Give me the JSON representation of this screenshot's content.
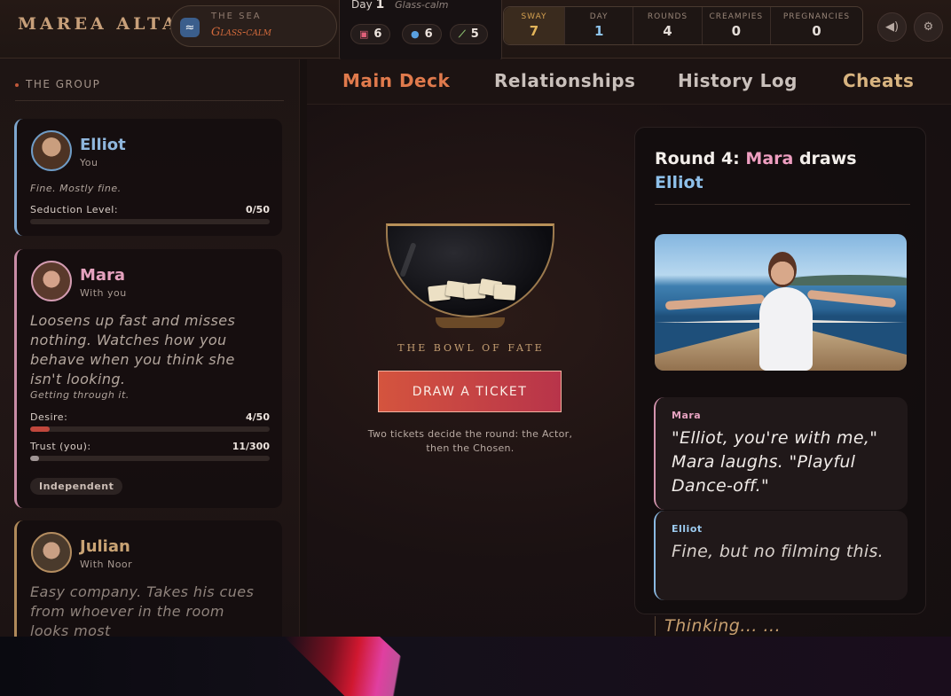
{
  "header": {
    "brand": "MAREA ALTA",
    "sea": {
      "label": "THE SEA",
      "value": "Glass-calm",
      "icon": "wave-icon"
    },
    "day": {
      "label": "Day",
      "number": "1",
      "condition": "Glass-calm"
    },
    "resources": [
      {
        "icon": "drink-icon",
        "value": "6"
      },
      {
        "icon": "droplet-icon",
        "value": "6"
      },
      {
        "icon": "bottle-icon",
        "value": "5"
      }
    ],
    "stats": [
      {
        "label": "SWAY",
        "value": "7"
      },
      {
        "label": "DAY",
        "value": "1"
      },
      {
        "label": "ROUNDS",
        "value": "4"
      },
      {
        "label": "CREAMPIES",
        "value": "0"
      },
      {
        "label": "PREGNANCIES",
        "value": "0"
      }
    ],
    "sound_icon": "speaker-icon",
    "settings_icon": "gear-icon"
  },
  "sidebar": {
    "title": "THE GROUP",
    "characters": [
      {
        "name": "Elliot",
        "subtitle": "You",
        "mood": "Fine. Mostly fine.",
        "meter_label": "Seduction Level:",
        "meter_value": "0/50",
        "meter_fraction": 0.0
      },
      {
        "name": "Mara",
        "subtitle": "With you",
        "description": "Loosens up fast and misses nothing. Watches how you behave when you think she isn't looking.",
        "mood": "Getting through it.",
        "desire_label": "Desire:",
        "desire_value": "4/50",
        "desire_fraction": 0.08,
        "trust_label": "Trust (you):",
        "trust_value": "11/300",
        "trust_fraction": 0.037,
        "tag": "Independent"
      },
      {
        "name": "Julian",
        "subtitle": "With Noor",
        "description": "Easy company. Takes his cues from whoever in the room looks most"
      }
    ]
  },
  "tabs": [
    {
      "label": "Main Deck",
      "active": true
    },
    {
      "label": "Relationships",
      "active": false
    },
    {
      "label": "History Log",
      "active": false
    },
    {
      "label": "Cheats",
      "active": false
    }
  ],
  "deck": {
    "bowl_caption": "THE BOWL OF FATE",
    "draw_button": "DRAW A TICKET",
    "note": "Two tickets decide the round: the Actor, then the Chosen."
  },
  "round": {
    "prefix": "Round 4:",
    "actor": "Mara",
    "verb": "draws",
    "chosen": "Elliot",
    "messages": [
      {
        "speaker": "Mara",
        "text": "\"Elliot, you're with me,\" Mara laughs. \"Playful Dance-off.\""
      },
      {
        "speaker": "Elliot",
        "text": "Fine, but no filming this."
      }
    ],
    "thinking": "Thinking... ..."
  },
  "colors": {
    "accent": "#e07a4c",
    "mara": "#e5a2be",
    "elliot": "#8fb6dc",
    "julian": "#c9a374",
    "gold": "#c49e72"
  }
}
